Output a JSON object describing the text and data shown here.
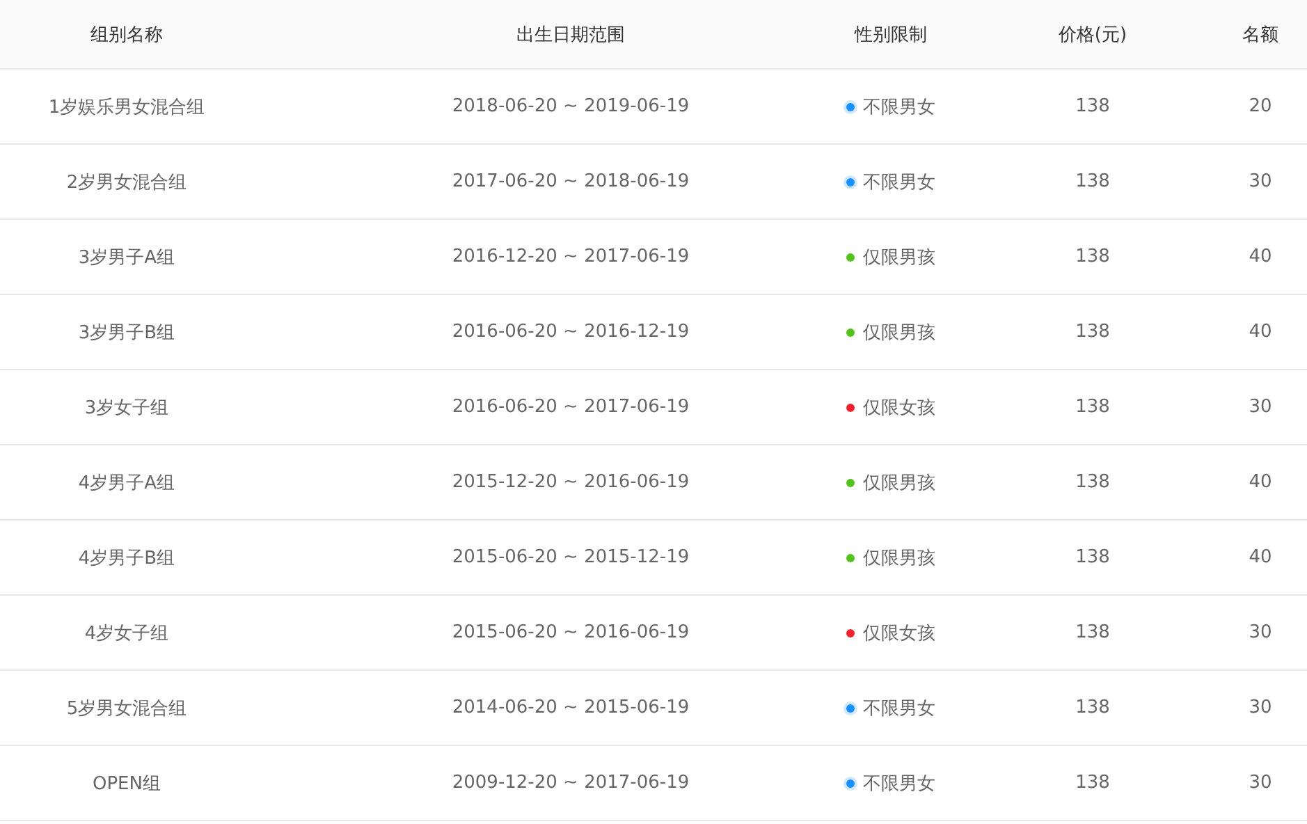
{
  "table": {
    "columns": [
      "组别名称",
      "出生日期范围",
      "性别限制",
      "价格(元)",
      "名额"
    ],
    "rows": [
      {
        "name": "1岁娱乐男女混合组",
        "dates": "2018-06-20 ~ 2019-06-19",
        "gender": {
          "label": "不限男女",
          "color": "#1890ff",
          "processing": true
        },
        "price": "138",
        "quota": "20"
      },
      {
        "name": "2岁男女混合组",
        "dates": "2017-06-20 ~ 2018-06-19",
        "gender": {
          "label": "不限男女",
          "color": "#1890ff",
          "processing": true
        },
        "price": "138",
        "quota": "30"
      },
      {
        "name": "3岁男子A组",
        "dates": "2016-12-20 ~ 2017-06-19",
        "gender": {
          "label": "仅限男孩",
          "color": "#52c41a",
          "processing": false
        },
        "price": "138",
        "quota": "40"
      },
      {
        "name": "3岁男子B组",
        "dates": "2016-06-20 ~ 2016-12-19",
        "gender": {
          "label": "仅限男孩",
          "color": "#52c41a",
          "processing": false
        },
        "price": "138",
        "quota": "40"
      },
      {
        "name": "3岁女子组",
        "dates": "2016-06-20 ~ 2017-06-19",
        "gender": {
          "label": "仅限女孩",
          "color": "#f5222d",
          "processing": false
        },
        "price": "138",
        "quota": "30"
      },
      {
        "name": "4岁男子A组",
        "dates": "2015-12-20 ~ 2016-06-19",
        "gender": {
          "label": "仅限男孩",
          "color": "#52c41a",
          "processing": false
        },
        "price": "138",
        "quota": "40"
      },
      {
        "name": "4岁男子B组",
        "dates": "2015-06-20 ~ 2015-12-19",
        "gender": {
          "label": "仅限男孩",
          "color": "#52c41a",
          "processing": false
        },
        "price": "138",
        "quota": "40"
      },
      {
        "name": "4岁女子组",
        "dates": "2015-06-20 ~ 2016-06-19",
        "gender": {
          "label": "仅限女孩",
          "color": "#f5222d",
          "processing": false
        },
        "price": "138",
        "quota": "30"
      },
      {
        "name": "5岁男女混合组",
        "dates": "2014-06-20 ~ 2015-06-19",
        "gender": {
          "label": "不限男女",
          "color": "#1890ff",
          "processing": true
        },
        "price": "138",
        "quota": "30"
      },
      {
        "name": "OPEN组",
        "dates": "2009-12-20 ~ 2017-06-19",
        "gender": {
          "label": "不限男女",
          "color": "#1890ff",
          "processing": true
        },
        "price": "138",
        "quota": "30"
      }
    ]
  }
}
